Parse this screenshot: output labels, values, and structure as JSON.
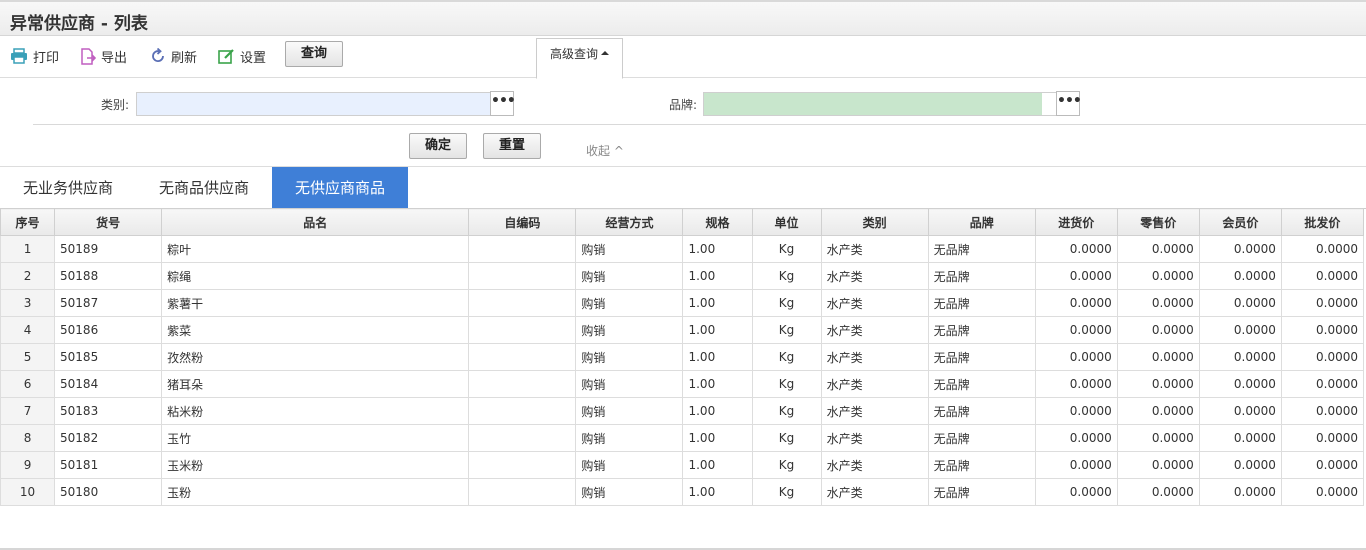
{
  "page": {
    "title": "异常供应商 - 列表"
  },
  "toolbar": {
    "print": "打印",
    "export": "导出",
    "refresh": "刷新",
    "settings": "设置",
    "query": "查询",
    "advanced": "高级查询"
  },
  "filters": {
    "category_label": "类别:",
    "category_value": "",
    "brand_label": "品牌:",
    "brand_value": "",
    "more_symbol": "•••",
    "confirm": "确定",
    "reset": "重置",
    "collapse": "收起 ^"
  },
  "colors": {
    "accent": "#3f7fd7",
    "category_input_bg": "#e8f0fe",
    "brand_input_bg": "#c8e6cc"
  },
  "tabs": [
    {
      "label": "无业务供应商",
      "active": false
    },
    {
      "label": "无商品供应商",
      "active": false
    },
    {
      "label": "无供应商商品",
      "active": true
    }
  ],
  "table": {
    "columns": [
      "序号",
      "货号",
      "品名",
      "自编码",
      "经营方式",
      "规格",
      "单位",
      "类别",
      "品牌",
      "进货价",
      "零售价",
      "会员价",
      "批发价"
    ],
    "rows": [
      [
        "1",
        "50189",
        "粽叶",
        "",
        "购销",
        "1.00",
        "Kg",
        "水产类",
        "无品牌",
        "0.0000",
        "0.0000",
        "0.0000",
        "0.0000"
      ],
      [
        "2",
        "50188",
        "粽绳",
        "",
        "购销",
        "1.00",
        "Kg",
        "水产类",
        "无品牌",
        "0.0000",
        "0.0000",
        "0.0000",
        "0.0000"
      ],
      [
        "3",
        "50187",
        "紫薯干",
        "",
        "购销",
        "1.00",
        "Kg",
        "水产类",
        "无品牌",
        "0.0000",
        "0.0000",
        "0.0000",
        "0.0000"
      ],
      [
        "4",
        "50186",
        "紫菜",
        "",
        "购销",
        "1.00",
        "Kg",
        "水产类",
        "无品牌",
        "0.0000",
        "0.0000",
        "0.0000",
        "0.0000"
      ],
      [
        "5",
        "50185",
        "孜然粉",
        "",
        "购销",
        "1.00",
        "Kg",
        "水产类",
        "无品牌",
        "0.0000",
        "0.0000",
        "0.0000",
        "0.0000"
      ],
      [
        "6",
        "50184",
        "猪耳朵",
        "",
        "购销",
        "1.00",
        "Kg",
        "水产类",
        "无品牌",
        "0.0000",
        "0.0000",
        "0.0000",
        "0.0000"
      ],
      [
        "7",
        "50183",
        "粘米粉",
        "",
        "购销",
        "1.00",
        "Kg",
        "水产类",
        "无品牌",
        "0.0000",
        "0.0000",
        "0.0000",
        "0.0000"
      ],
      [
        "8",
        "50182",
        "玉竹",
        "",
        "购销",
        "1.00",
        "Kg",
        "水产类",
        "无品牌",
        "0.0000",
        "0.0000",
        "0.0000",
        "0.0000"
      ],
      [
        "9",
        "50181",
        "玉米粉",
        "",
        "购销",
        "1.00",
        "Kg",
        "水产类",
        "无品牌",
        "0.0000",
        "0.0000",
        "0.0000",
        "0.0000"
      ],
      [
        "10",
        "50180",
        "玉粉",
        "",
        "购销",
        "1.00",
        "Kg",
        "水产类",
        "无品牌",
        "0.0000",
        "0.0000",
        "0.0000",
        "0.0000"
      ]
    ]
  }
}
